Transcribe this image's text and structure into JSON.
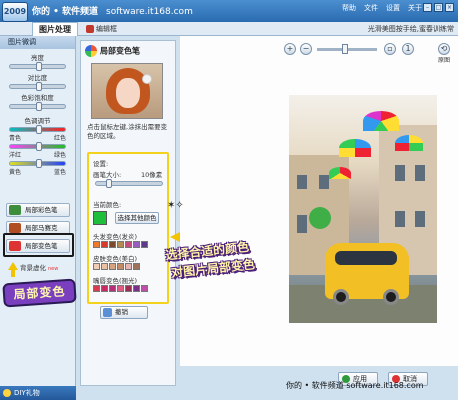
{
  "top": {
    "site_name": "你的 • 软件频道",
    "site_url": "software.it168.com",
    "menu": [
      "帮助",
      "文件",
      "设置",
      "关于"
    ]
  },
  "tabs": {
    "active": "图片处理",
    "sub": "编辑框",
    "hint": "光滑美图按手绘,蜜春训练常"
  },
  "left": {
    "header": "图片微调",
    "sliders": [
      {
        "label": "亮度",
        "level": 0.5
      },
      {
        "label": "对比度",
        "level": 0.5
      },
      {
        "label": "色彩饱和度",
        "level": 0.5
      }
    ],
    "color_title": "色调调节",
    "color_sliders": [
      {
        "left": "青色",
        "right": "红色",
        "level": 0.5
      },
      {
        "left": "洋红",
        "right": "绿色",
        "level": 0.5
      },
      {
        "left": "黄色",
        "right": "蓝色",
        "level": 0.5
      }
    ],
    "tools": [
      "局部彩色笔",
      "局部马赛克",
      "局部变色笔"
    ],
    "bg_blur": "背景虚化",
    "bg_blur_badge": "new",
    "annotation": "局部变色",
    "bottom": "DIY礼物"
  },
  "middle": {
    "title": "局部变色笔",
    "description": "点击鼠标左键,涂抹出需要变色的区域。",
    "settings": "设置:",
    "brush_label": "画笔大小:",
    "brush_value": "10像素",
    "current_color_label": "当前颜色:",
    "current_color": "#1fbe3b",
    "other_color_button": "选择其他颜色",
    "hair_label": "头发变色(发炎)",
    "skin_label": "皮肤变色(美白)",
    "lip_label": "嘴唇变色(翘光)",
    "hair_colors": [
      "#f07a2a",
      "#d8392b",
      "#7a4a2b",
      "#b58a52",
      "#c94a7f",
      "#9a5cc2",
      "#5b3a8a"
    ],
    "skin_colors": [
      "#f2cdb3",
      "#ecc0a2",
      "#d9a27e",
      "#c58a66",
      "#e8b5b5",
      "#a0725a"
    ],
    "lip_colors": [
      "#d93b4f",
      "#c92a65",
      "#b6317a",
      "#e05c82",
      "#9c2e4f",
      "#7a2f8c",
      "#c04da8"
    ],
    "undo": "撤销"
  },
  "right": {
    "zoom_label": "原图",
    "annotation_line1": "选择合适的颜色",
    "annotation_line2": "对图片局部变色",
    "apply": "应用",
    "cancel": "取消"
  },
  "watermark": "你的 • 软件频道 software.it168.com"
}
